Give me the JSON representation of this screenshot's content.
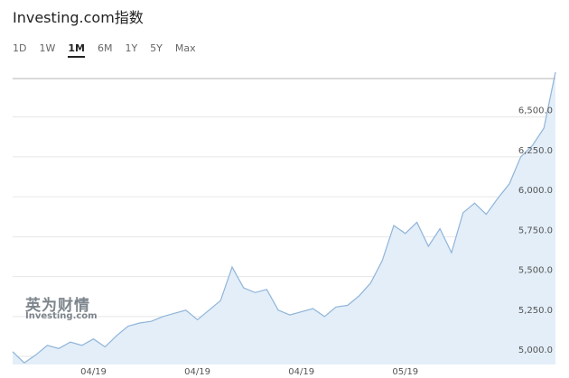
{
  "header": {
    "title": "Investing.com指数"
  },
  "ranges": [
    {
      "label": "1D",
      "active": false
    },
    {
      "label": "1W",
      "active": false
    },
    {
      "label": "1M",
      "active": true
    },
    {
      "label": "6M",
      "active": false
    },
    {
      "label": "1Y",
      "active": false
    },
    {
      "label": "5Y",
      "active": false
    },
    {
      "label": "Max",
      "active": false
    }
  ],
  "watermark": {
    "cn": "英为财情",
    "en": "Investing.com"
  },
  "colors": {
    "line": "#8fb4d9",
    "fill": "#e3eef8",
    "grid": "#e6e6e6",
    "last_line": "#b3b3b3"
  },
  "chart_data": {
    "type": "area",
    "ylim": [
      4950,
      6780
    ],
    "yticks": [
      {
        "value": 5000,
        "label": "5,000.0"
      },
      {
        "value": 5250,
        "label": "5,250.0"
      },
      {
        "value": 5500,
        "label": "5,500.0"
      },
      {
        "value": 5750,
        "label": "5,750.0"
      },
      {
        "value": 6000,
        "label": "6,000.0"
      },
      {
        "value": 6250,
        "label": "6,250.0"
      },
      {
        "value": 6500,
        "label": "6,500.0"
      }
    ],
    "xticks": [
      {
        "index": 7,
        "label": "04/19"
      },
      {
        "index": 16,
        "label": "04/19"
      },
      {
        "index": 25,
        "label": "04/19"
      },
      {
        "index": 34,
        "label": "05/19"
      }
    ],
    "last_value": 6740,
    "values": [
      5030,
      4960,
      5010,
      5070,
      5050,
      5090,
      5070,
      5110,
      5060,
      5130,
      5190,
      5210,
      5220,
      5250,
      5270,
      5290,
      5230,
      5290,
      5350,
      5560,
      5430,
      5400,
      5420,
      5290,
      5260,
      5280,
      5300,
      5250,
      5310,
      5320,
      5380,
      5460,
      5600,
      5820,
      5770,
      5840,
      5690,
      5800,
      5650,
      5900,
      5960,
      5890,
      5990,
      6080,
      6250,
      6320,
      6430,
      6780
    ]
  }
}
